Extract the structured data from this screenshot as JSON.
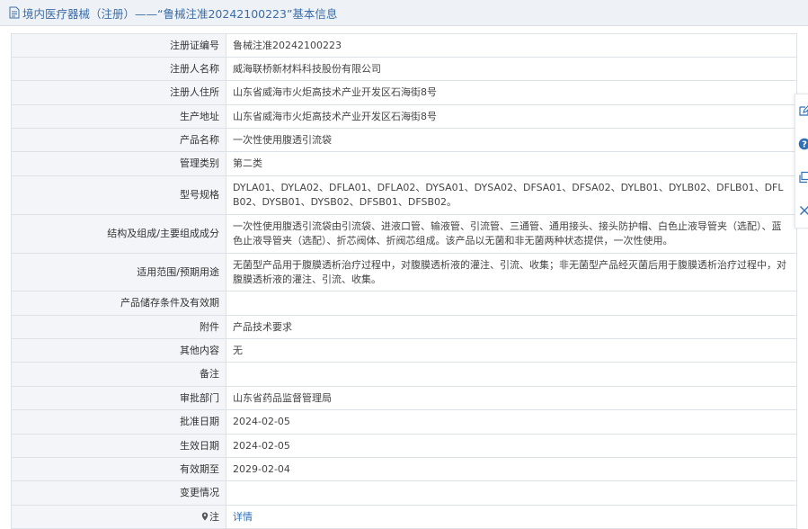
{
  "header": {
    "title": "境内医疗器械（注册）——“鲁械注准20242100223”基本信息",
    "icon": "document-icon"
  },
  "fields": [
    {
      "label": "注册证编号",
      "value": "鲁械注准20242100223"
    },
    {
      "label": "注册人名称",
      "value": "威海联桥新材料科技股份有限公司"
    },
    {
      "label": "注册人住所",
      "value": "山东省威海市火炬高技术产业开发区石海街8号"
    },
    {
      "label": "生产地址",
      "value": "山东省威海市火炬高技术产业开发区石海街8号"
    },
    {
      "label": "产品名称",
      "value": "一次性使用腹透引流袋"
    },
    {
      "label": "管理类别",
      "value": "第二类"
    },
    {
      "label": "型号规格",
      "value": "DYLA01、DYLA02、DFLA01、DFLA02、DYSA01、DYSA02、DFSA01、DFSA02、DYLB01、DYLB02、DFLB01、DFLB02、DYSB01、DYSB02、DFSB01、DFSB02。"
    },
    {
      "label": "结构及组成/主要组成成分",
      "value": "一次性使用腹透引流袋由引流袋、进液口管、输液管、引流管、三通管、通用接头、接头防护帽、白色止液导管夹（选配）、蓝色止液导管夹（选配）、折芯阀体、折阀芯组成。该产品以无菌和非无菌两种状态提供，一次性使用。"
    },
    {
      "label": "适用范围/预期用途",
      "value": "无菌型产品用于腹膜透析治疗过程中，对腹膜透析液的灌注、引流、收集；非无菌型产品经灭菌后用于腹膜透析治疗过程中，对腹膜透析液的灌注、引流、收集。"
    },
    {
      "label": "产品储存条件及有效期",
      "value": ""
    },
    {
      "label": "附件",
      "value": "产品技术要求"
    },
    {
      "label": "其他内容",
      "value": "无"
    },
    {
      "label": "备注",
      "value": ""
    },
    {
      "label": "审批部门",
      "value": "山东省药品监督管理局"
    },
    {
      "label": "批准日期",
      "value": "2024-02-05"
    },
    {
      "label": "生效日期",
      "value": "2024-02-05"
    },
    {
      "label": "有效期至",
      "value": "2029-02-04"
    },
    {
      "label": "变更情况",
      "value": ""
    }
  ],
  "note_row": {
    "label": "注",
    "link_text": "详情",
    "icon": "map-pin-icon"
  },
  "side_toolbar": {
    "icons": [
      "edit-icon",
      "help-icon",
      "copy-icon",
      "close-icon"
    ],
    "accent": "#2f6fb7"
  },
  "colors": {
    "header_bg": "#eef1f5",
    "header_text": "#3b6ea8",
    "label_bg": "#f3f5f8",
    "border": "#dde2e8",
    "link": "#2f6fb7"
  }
}
